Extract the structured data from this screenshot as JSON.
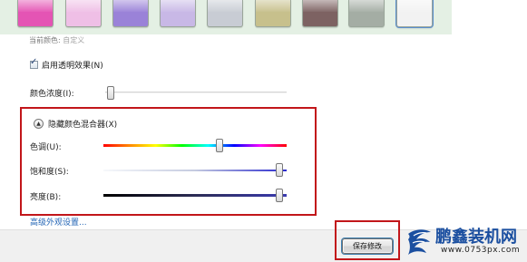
{
  "swatches": [
    {
      "name": "pink",
      "color": "#e454b4"
    },
    {
      "name": "light-pink",
      "color": "#efbfe6"
    },
    {
      "name": "purple",
      "color": "#9a82d8"
    },
    {
      "name": "lavender",
      "color": "#c8b8e6"
    },
    {
      "name": "silver",
      "color": "#c8ccd4"
    },
    {
      "name": "olive",
      "color": "#c7c08c"
    },
    {
      "name": "brown",
      "color": "#7d6262"
    },
    {
      "name": "gray-green",
      "color": "#a4ada4"
    },
    {
      "name": "white",
      "color": "#f2f2f2"
    }
  ],
  "current_color": {
    "label": "当前颜色:",
    "value": "自定义"
  },
  "transparency": {
    "label": "启用透明效果(N)",
    "checked": true
  },
  "intensity": {
    "label": "颜色浓度(I):",
    "level": 0.02
  },
  "mixer": {
    "toggle_label": "隐藏颜色混合器(X)",
    "hue": {
      "label": "色调(U):",
      "level": 0.64
    },
    "saturation": {
      "label": "饱和度(S):",
      "level": 0.98
    },
    "brightness": {
      "label": "亮度(B):",
      "level": 0.98
    }
  },
  "advanced_link": "高级外观设置...",
  "save_button": "保存修改",
  "watermark": {
    "title": "鹏鑫装机网",
    "url": "www.0753px.com"
  },
  "colors": {
    "highlight_red": "#c2161a",
    "link_blue": "#2667b6",
    "brand_blue": "#1b4fa0"
  }
}
